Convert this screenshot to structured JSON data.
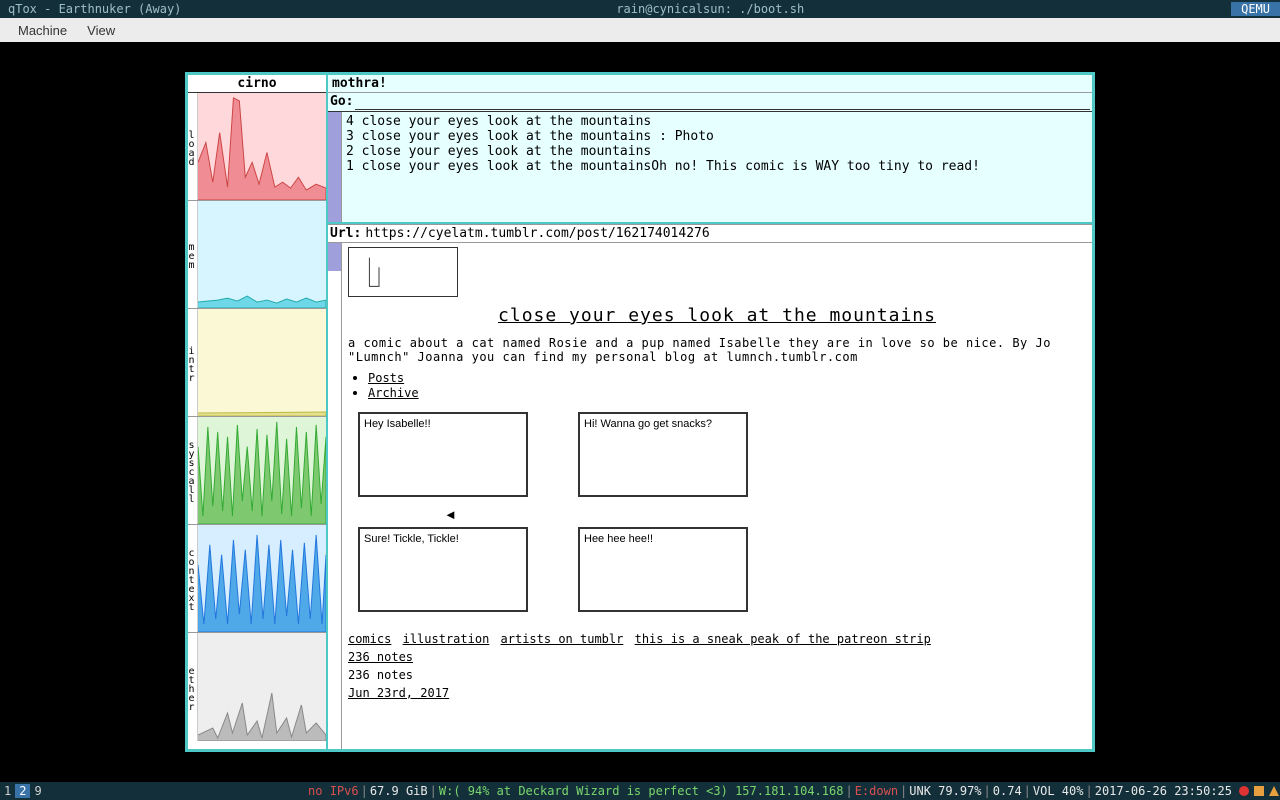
{
  "taskbar": {
    "left": "qTox - Earthnuker (Away)",
    "center": "rain@cynicalsun: ./boot.sh",
    "right": "QEMU"
  },
  "menubar": {
    "items": [
      "Machine",
      "View"
    ]
  },
  "cirno": {
    "title": "cirno",
    "graphs": [
      "load",
      "mem",
      "intr",
      "syscall",
      "context",
      "ether"
    ]
  },
  "mothra": {
    "title": "mothra!",
    "go_label": "Go:",
    "history": [
      "4 close your eyes look at the mountains",
      "3 close your eyes look at the mountains : Photo",
      "2 close your eyes look at the mountains",
      "1 close your eyes look at the mountainsOh no! This comic is WAY too tiny to read!"
    ],
    "url_label": "Url:",
    "url": "https://cyelatm.tumblr.com/post/162174014276"
  },
  "page": {
    "title": "close your eyes look at the mountains",
    "description": "a comic about a cat named Rosie and a pup named Isabelle they are in love so be nice. By Jo \"Lumnch\" Joanna you can find my personal blog at lumnch.tumblr.com",
    "links": [
      "Posts",
      "Archive"
    ],
    "panels": [
      "Hey Isabelle!!",
      "Hi! Wanna go get snacks?",
      "Sure! Tickle, Tickle!",
      "Hee hee hee!!"
    ],
    "tags": [
      "comics",
      "illustration",
      "artists on tumblr",
      "this is a sneak peak of the patreon strip"
    ],
    "notes_link": "236 notes",
    "notes_plain": "236 notes",
    "date": "Jun 23rd, 2017"
  },
  "bottombar": {
    "workspaces": [
      "1",
      "2",
      "9"
    ],
    "ipv6": "no IPv6",
    "mem": "67.9 GiB",
    "wifi_label": "W:",
    "wifi_text": "( 94% at Deckard Wizard is perfect <3) 157.181.104.168",
    "eth_label": "E:",
    "eth_text": "down",
    "unk": "UNK 79.97%",
    "load": "0.74",
    "vol": "VOL 40%",
    "datetime": "2017-06-26 23:50:25"
  }
}
